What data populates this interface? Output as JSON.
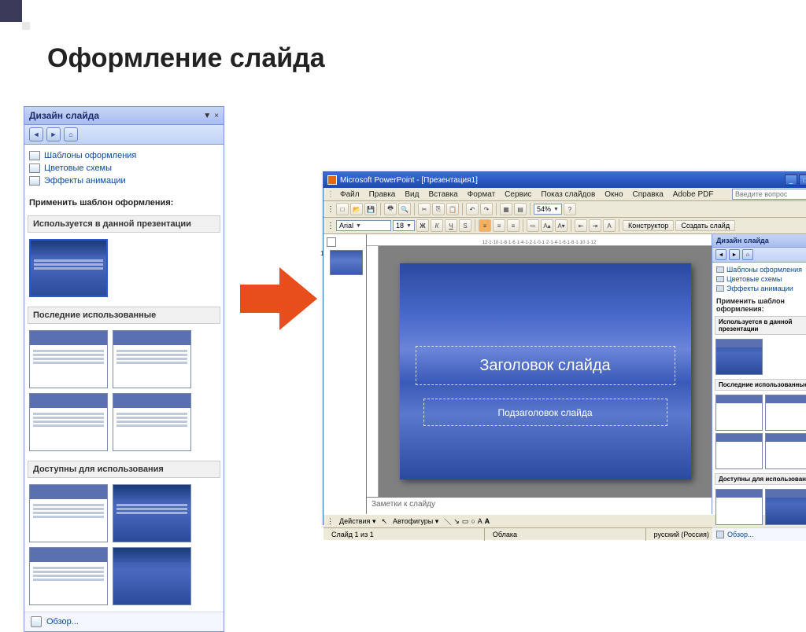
{
  "page": {
    "title": "Оформление слайда"
  },
  "taskpane": {
    "title": "Дизайн слайда",
    "dropdown": "▼",
    "close": "×",
    "links": {
      "templates": "Шаблоны оформления",
      "colors": "Цветовые схемы",
      "animations": "Эффекты анимации"
    },
    "apply_label": "Применить шаблон оформления:",
    "sections": {
      "used": "Используется в данной презентации",
      "recent": "Последние использованные",
      "available": "Доступны для использования"
    },
    "browse": "Обзор..."
  },
  "pp": {
    "title": "Microsoft PowerPoint - [Презентация1]",
    "menu": [
      "Файл",
      "Правка",
      "Вид",
      "Вставка",
      "Формат",
      "Сервис",
      "Показ слайдов",
      "Окно",
      "Справка",
      "Adobe PDF"
    ],
    "question_placeholder": "Введите вопрос",
    "font_name": "Arial",
    "font_size": "18",
    "zoom": "54%",
    "designer_btn": "Конструктор",
    "new_slide_btn": "Создать слайд",
    "ruler": "12·1·10·1·8·1·6·1·4·1·2·1·0·1·2·1·4·1·6·1·8·1·10·1·12",
    "slide_num": "1",
    "slide": {
      "title_ph": "Заголовок слайда",
      "subtitle_ph": "Подзаголовок слайда"
    },
    "notes_ph": "Заметки к слайду",
    "draw": {
      "actions": "Действия",
      "autoshapes": "Автофигуры"
    },
    "status": {
      "slide": "Слайд 1 из 1",
      "template": "Облака",
      "lang": "русский (Россия)"
    }
  }
}
